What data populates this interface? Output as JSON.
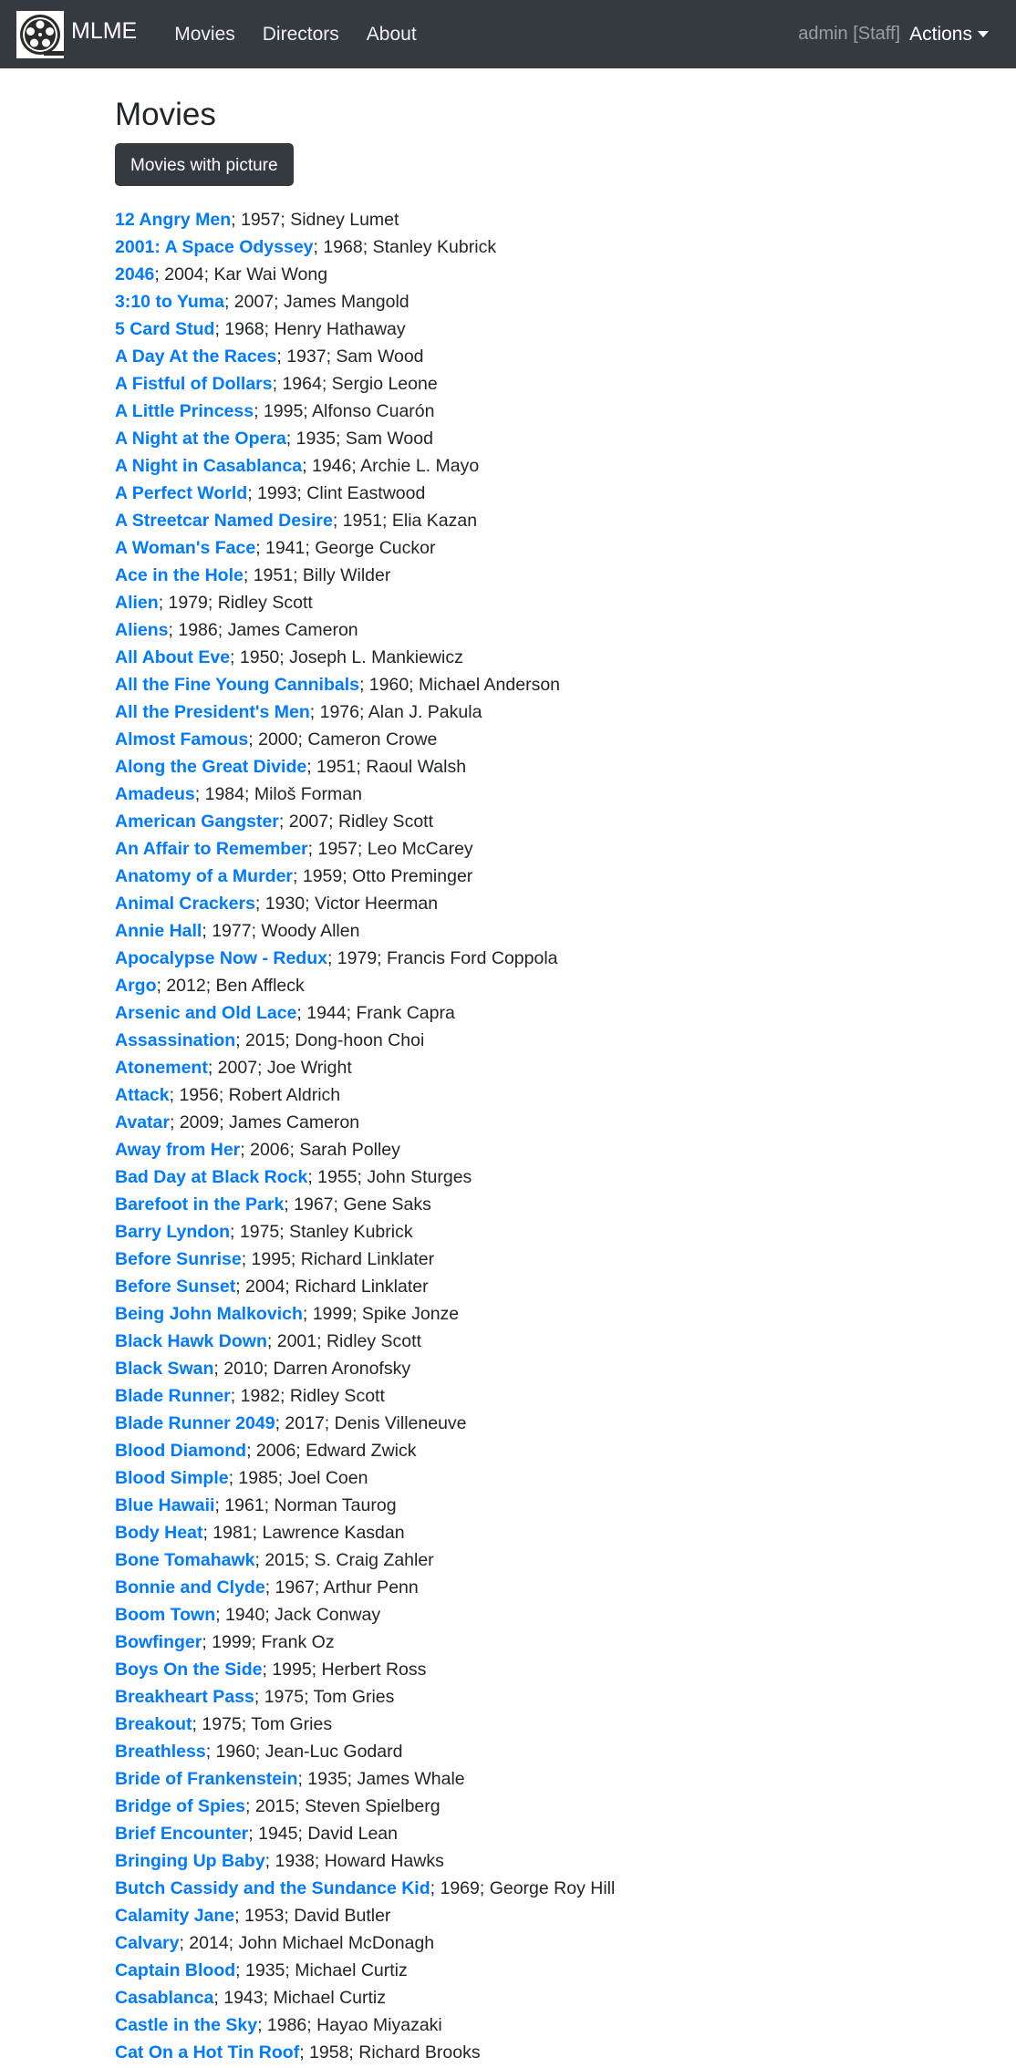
{
  "navbar": {
    "brand": "MLME",
    "links": [
      "Movies",
      "Directors",
      "About"
    ],
    "user": "admin [Staff]",
    "actions_label": "Actions"
  },
  "page": {
    "title": "Movies",
    "button_label": "Movies with picture"
  },
  "movies": [
    {
      "title": "12 Angry Men",
      "details": "; 1957; Sidney Lumet"
    },
    {
      "title": "2001: A Space Odyssey",
      "details": "; 1968; Stanley Kubrick"
    },
    {
      "title": "2046",
      "details": "; 2004; Kar Wai Wong"
    },
    {
      "title": "3:10 to Yuma",
      "details": "; 2007; James Mangold"
    },
    {
      "title": "5 Card Stud",
      "details": "; 1968; Henry Hathaway"
    },
    {
      "title": "A Day At the Races",
      "details": "; 1937; Sam Wood"
    },
    {
      "title": "A Fistful of Dollars",
      "details": "; 1964; Sergio Leone"
    },
    {
      "title": "A Little Princess",
      "details": "; 1995; Alfonso Cuarón"
    },
    {
      "title": "A Night at the Opera",
      "details": "; 1935; Sam Wood"
    },
    {
      "title": "A Night in Casablanca",
      "details": "; 1946; Archie L. Mayo"
    },
    {
      "title": "A Perfect World",
      "details": "; 1993; Clint Eastwood"
    },
    {
      "title": "A Streetcar Named Desire",
      "details": "; 1951; Elia Kazan"
    },
    {
      "title": "A Woman's Face",
      "details": "; 1941; George Cuckor"
    },
    {
      "title": "Ace in the Hole",
      "details": "; 1951; Billy Wilder"
    },
    {
      "title": "Alien",
      "details": "; 1979; Ridley Scott"
    },
    {
      "title": "Aliens",
      "details": "; 1986; James Cameron"
    },
    {
      "title": "All About Eve",
      "details": "; 1950; Joseph L. Mankiewicz"
    },
    {
      "title": "All the Fine Young Cannibals",
      "details": "; 1960; Michael Anderson"
    },
    {
      "title": "All the President's Men",
      "details": "; 1976; Alan J. Pakula"
    },
    {
      "title": "Almost Famous",
      "details": "; 2000; Cameron Crowe"
    },
    {
      "title": "Along the Great Divide",
      "details": "; 1951; Raoul Walsh"
    },
    {
      "title": "Amadeus",
      "details": "; 1984; Miloš Forman"
    },
    {
      "title": "American Gangster",
      "details": "; 2007; Ridley Scott"
    },
    {
      "title": "An Affair to Remember",
      "details": "; 1957; Leo McCarey"
    },
    {
      "title": "Anatomy of a Murder",
      "details": "; 1959; Otto Preminger"
    },
    {
      "title": "Animal Crackers",
      "details": "; 1930; Victor Heerman"
    },
    {
      "title": "Annie Hall",
      "details": "; 1977; Woody Allen"
    },
    {
      "title": "Apocalypse Now - Redux",
      "details": "; 1979; Francis Ford Coppola"
    },
    {
      "title": "Argo",
      "details": "; 2012; Ben Affleck"
    },
    {
      "title": "Arsenic and Old Lace",
      "details": "; 1944; Frank Capra"
    },
    {
      "title": "Assassination",
      "details": "; 2015; Dong-hoon Choi"
    },
    {
      "title": "Atonement",
      "details": "; 2007; Joe Wright"
    },
    {
      "title": "Attack",
      "details": "; 1956; Robert Aldrich"
    },
    {
      "title": "Avatar",
      "details": "; 2009; James Cameron"
    },
    {
      "title": "Away from Her",
      "details": "; 2006; Sarah Polley"
    },
    {
      "title": "Bad Day at Black Rock",
      "details": "; 1955; John Sturges"
    },
    {
      "title": "Barefoot in the Park",
      "details": "; 1967; Gene Saks"
    },
    {
      "title": "Barry Lyndon",
      "details": "; 1975; Stanley Kubrick"
    },
    {
      "title": "Before Sunrise",
      "details": "; 1995; Richard Linklater"
    },
    {
      "title": "Before Sunset",
      "details": "; 2004; Richard Linklater"
    },
    {
      "title": "Being John Malkovich",
      "details": "; 1999; Spike Jonze"
    },
    {
      "title": "Black Hawk Down",
      "details": "; 2001; Ridley Scott"
    },
    {
      "title": "Black Swan",
      "details": "; 2010; Darren Aronofsky"
    },
    {
      "title": "Blade Runner",
      "details": "; 1982; Ridley Scott"
    },
    {
      "title": "Blade Runner 2049",
      "details": "; 2017; Denis Villeneuve"
    },
    {
      "title": "Blood Diamond",
      "details": "; 2006; Edward Zwick"
    },
    {
      "title": "Blood Simple",
      "details": "; 1985; Joel Coen"
    },
    {
      "title": "Blue Hawaii",
      "details": "; 1961; Norman Taurog"
    },
    {
      "title": "Body Heat",
      "details": "; 1981; Lawrence Kasdan"
    },
    {
      "title": "Bone Tomahawk",
      "details": "; 2015; S. Craig Zahler"
    },
    {
      "title": "Bonnie and Clyde",
      "details": "; 1967; Arthur Penn"
    },
    {
      "title": "Boom Town",
      "details": "; 1940; Jack Conway"
    },
    {
      "title": "Bowfinger",
      "details": "; 1999; Frank Oz"
    },
    {
      "title": "Boys On the Side",
      "details": "; 1995; Herbert Ross"
    },
    {
      "title": "Breakheart Pass",
      "details": "; 1975; Tom Gries"
    },
    {
      "title": "Breakout",
      "details": "; 1975; Tom Gries"
    },
    {
      "title": "Breathless",
      "details": "; 1960; Jean-Luc Godard"
    },
    {
      "title": "Bride of Frankenstein",
      "details": "; 1935; James Whale"
    },
    {
      "title": "Bridge of Spies",
      "details": "; 2015; Steven Spielberg"
    },
    {
      "title": "Brief Encounter",
      "details": "; 1945; David Lean"
    },
    {
      "title": "Bringing Up Baby",
      "details": "; 1938; Howard Hawks"
    },
    {
      "title": "Butch Cassidy and the Sundance Kid",
      "details": "; 1969; George Roy Hill"
    },
    {
      "title": "Calamity Jane",
      "details": "; 1953; David Butler"
    },
    {
      "title": "Calvary",
      "details": "; 2014; John Michael McDonagh"
    },
    {
      "title": "Captain Blood",
      "details": "; 1935; Michael Curtiz"
    },
    {
      "title": "Casablanca",
      "details": "; 1943; Michael Curtiz"
    },
    {
      "title": "Castle in the Sky",
      "details": "; 1986; Hayao Miyazaki"
    },
    {
      "title": "Cat On a Hot Tin Roof",
      "details": "; 1958; Richard Brooks"
    }
  ]
}
